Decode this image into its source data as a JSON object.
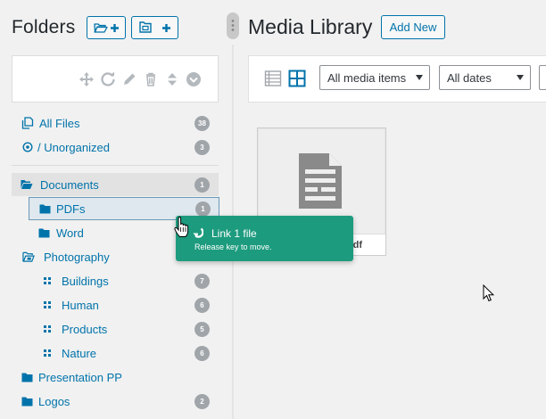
{
  "folders_panel": {
    "title": "Folders",
    "new_folder_button_icons": [
      "folder-open-icon",
      "plus-icon"
    ],
    "new_gallery_button_icons": [
      "gallery-folder-icon",
      "plus-icon"
    ],
    "toolbar_icons": [
      "move-icon",
      "refresh-icon",
      "pencil-icon",
      "trash-icon",
      "sort-icon",
      "chevron-down-circle-icon"
    ]
  },
  "tree": {
    "all_files": {
      "label": "All Files",
      "count": "38"
    },
    "unorganized": {
      "label": "/ Unorganized",
      "count": "3"
    },
    "items": [
      {
        "label": "Documents",
        "count": "1"
      },
      {
        "label": "PDFs",
        "count": "1"
      },
      {
        "label": "Word",
        "count": ""
      },
      {
        "label": "Photography",
        "count": ""
      },
      {
        "label": "Buildings",
        "count": "7"
      },
      {
        "label": "Human",
        "count": "6"
      },
      {
        "label": "Products",
        "count": "5"
      },
      {
        "label": "Nature",
        "count": "6"
      },
      {
        "label": "Presentation PP",
        "count": ""
      },
      {
        "label": "Logos",
        "count": "2"
      }
    ]
  },
  "media_library": {
    "title": "Media Library",
    "add_new_label": "Add New",
    "filter_type": "All media items",
    "filter_date": "All dates",
    "attachment_filename_fragment": "df"
  },
  "drag_tooltip": {
    "title": "Link 1 file",
    "subtitle": "Release key to move."
  },
  "colors": {
    "accent": "#0073aa",
    "badge": "#a0a5aa",
    "tooltip": "#1d9b7e",
    "background": "#f1f1f1"
  }
}
